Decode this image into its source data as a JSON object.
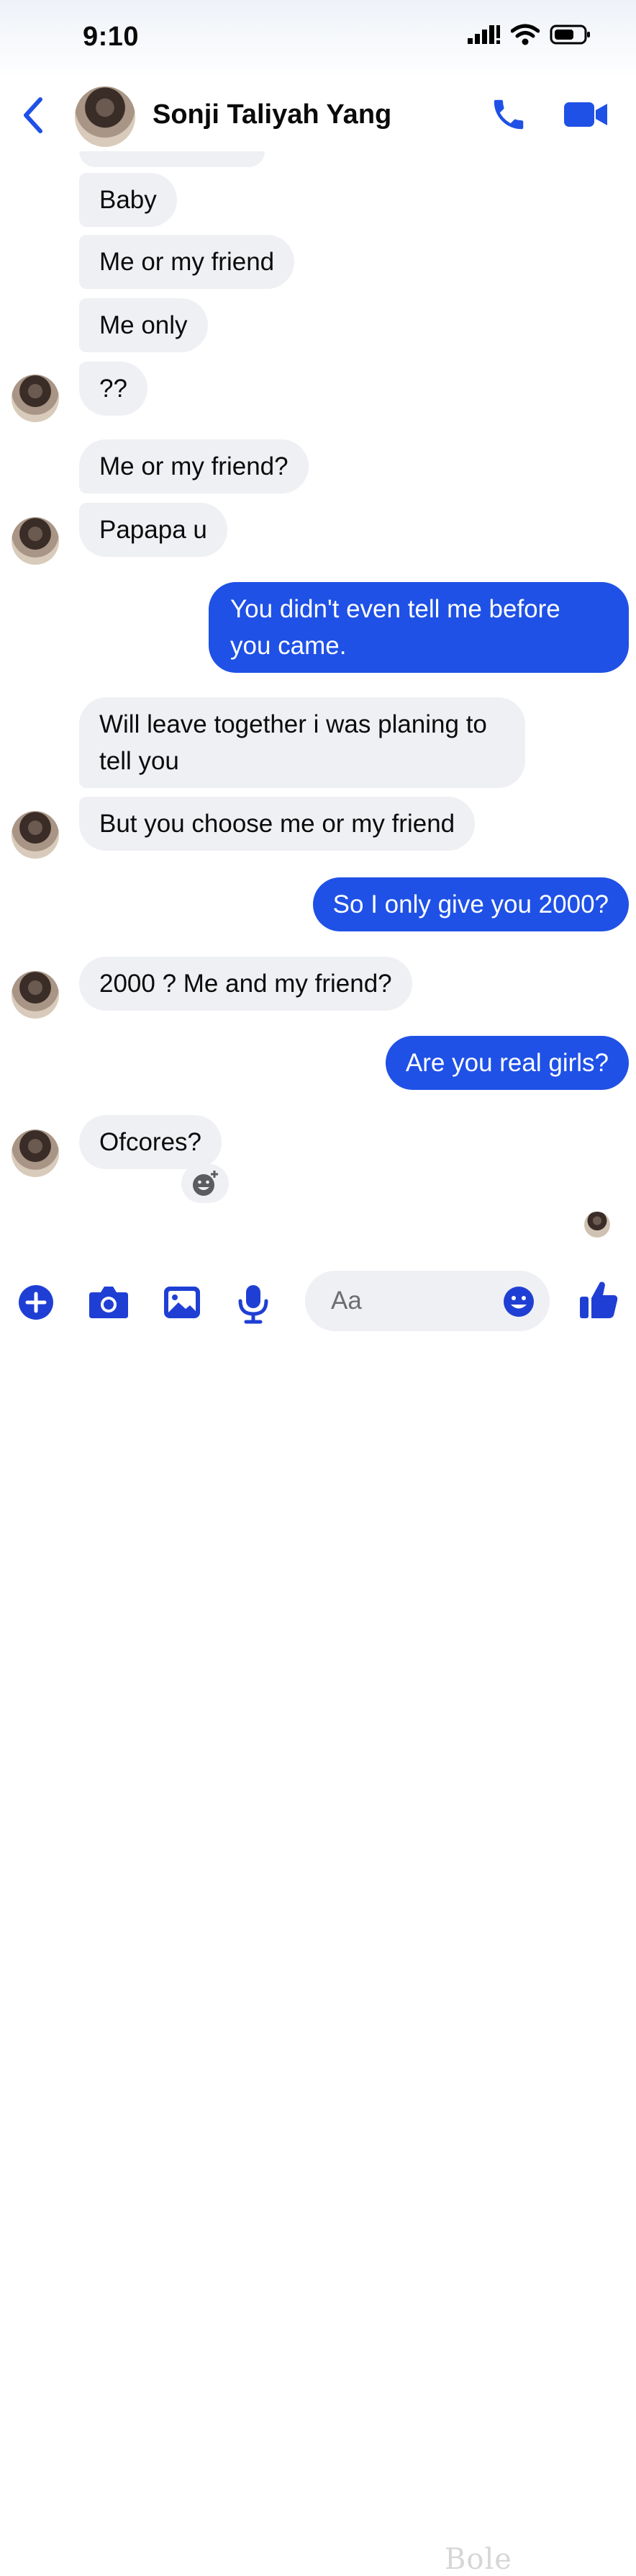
{
  "status_bar": {
    "time": "9:10"
  },
  "header": {
    "contact_name": "Sonji Taliyah Yang"
  },
  "messages": [
    {
      "text": "Baby"
    },
    {
      "text": "Me or my friend"
    },
    {
      "text": "Me only"
    },
    {
      "text": "??"
    },
    {
      "text": "Me or my friend?"
    },
    {
      "text": "Papapa u"
    },
    {
      "text": "You didn't even tell me before you came."
    },
    {
      "text": "Will leave together i was planing to tell you"
    },
    {
      "text": "But you choose me or my friend"
    },
    {
      "text": "So I only give you 2000?"
    },
    {
      "text": "2000 ? Me and my friend?"
    },
    {
      "text": "Are you real girls?"
    },
    {
      "text": "Ofcores?"
    }
  ],
  "composer": {
    "placeholder": "Aa"
  },
  "watermark": {
    "text": "Bole"
  },
  "colors": {
    "accent": "#1f51e6",
    "incoming_bubble": "#eff0f3",
    "outgoing_bubble": "#1f51e6"
  }
}
